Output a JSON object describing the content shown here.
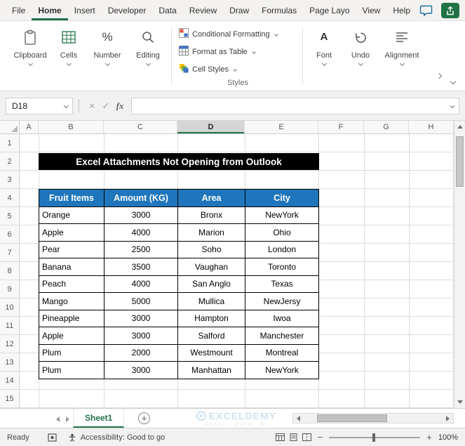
{
  "colors": {
    "excel_green": "#217346",
    "table_header_blue": "#1F76BC",
    "banner_bg": "#000000",
    "banner_text_color": "#FFFFFF"
  },
  "menu_bar": {
    "tabs": [
      "File",
      "Home",
      "Insert",
      "Developer",
      "Data",
      "Review",
      "Draw",
      "Formulas",
      "Page Layo",
      "View",
      "Help"
    ],
    "active_tab": "Home"
  },
  "ribbon": {
    "groups_left": [
      {
        "label": "Clipboard"
      },
      {
        "label": "Cells"
      },
      {
        "label": "Number"
      },
      {
        "label": "Editing"
      }
    ],
    "styles_group": {
      "caption": "Styles",
      "items": [
        {
          "label": "Conditional Formatting"
        },
        {
          "label": "Format as Table"
        },
        {
          "label": "Cell Styles"
        }
      ]
    },
    "groups_right": [
      {
        "label": "Font"
      },
      {
        "label": "Undo"
      },
      {
        "label": "Alignment"
      }
    ]
  },
  "icons": {
    "font_glyph": "A",
    "percent_glyph": "%",
    "add_sheet": "+",
    "zoom_out": "−",
    "zoom_in": "+"
  },
  "formula_bar": {
    "name_box_value": "D18",
    "cancel_glyph": "×",
    "enter_glyph": "✓",
    "fx_label": "fx",
    "formula_value": ""
  },
  "grid": {
    "column_headers": [
      "A",
      "B",
      "C",
      "D",
      "E",
      "F",
      "G",
      "H"
    ],
    "selected_column": "D",
    "selected_cell": "D18",
    "row_headers": [
      "1",
      "2",
      "3",
      "4",
      "5",
      "6",
      "7",
      "8",
      "9",
      "10",
      "11",
      "12",
      "13",
      "14",
      "15"
    ],
    "banner_text": "Excel Attachments Not Opening from Outlook",
    "table": {
      "headers": [
        "Fruit Items",
        "Amount (KG)",
        "Area",
        "City"
      ],
      "rows": [
        [
          "Orange",
          "3000",
          "Bronx",
          "NewYork"
        ],
        [
          "Apple",
          "4000",
          "Marion",
          "Ohio"
        ],
        [
          "Pear",
          "2500",
          "Soho",
          "London"
        ],
        [
          "Banana",
          "3500",
          "Vaughan",
          "Toronto"
        ],
        [
          "Peach",
          "4000",
          "San Anglo",
          "Texas"
        ],
        [
          "Mango",
          "5000",
          "Mullica",
          "NewJersy"
        ],
        [
          "Pineapple",
          "3000",
          "Hampton",
          "Iwoa"
        ],
        [
          "Apple",
          "3000",
          "Salford",
          "Manchester"
        ],
        [
          "Plum",
          "2000",
          "Westmount",
          "Montreal"
        ],
        [
          "Plum",
          "3000",
          "Manhattan",
          "NewYork"
        ]
      ]
    }
  },
  "sheet_bar": {
    "active_sheet": "Sheet1",
    "watermark_title": "EXCELDEMY",
    "watermark_subtitle": "EXCEL · DATA · BI"
  },
  "status_bar": {
    "mode": "Ready",
    "accessibility_text": "Accessibility: Good to go",
    "zoom_percent": "100%"
  }
}
